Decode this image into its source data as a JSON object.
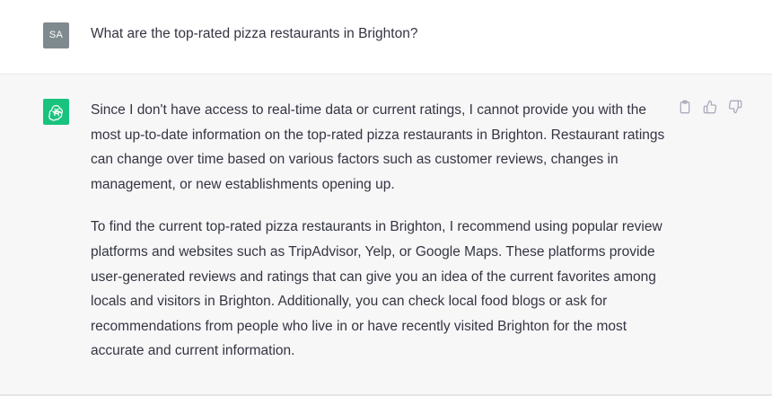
{
  "user_message": {
    "avatar_initials": "SA",
    "text": "What are the top-rated pizza restaurants in Brighton?"
  },
  "assistant_message": {
    "paragraphs": [
      "Since I don't have access to real-time data or current ratings, I cannot provide you with the most up-to-date information on the top-rated pizza restaurants in Brighton. Restaurant ratings can change over time based on various factors such as customer reviews, changes in management, or new establishments opening up.",
      "To find the current top-rated pizza restaurants in Brighton, I recommend using popular review platforms and websites such as TripAdvisor, Yelp, or Google Maps. These platforms provide user-generated reviews and ratings that can give you an idea of the current favorites among locals and visitors in Brighton. Additionally, you can check local food blogs or ask for recommendations from people who live in or have recently visited Brighton for the most accurate and current information."
    ],
    "actions": [
      "clipboard-icon",
      "thumbs-up-icon",
      "thumbs-down-icon"
    ]
  },
  "colors": {
    "user_avatar": "#7f8a8e",
    "assistant_avatar": "#19c37d",
    "assistant_bg": "#f7f7f8",
    "text": "#343541",
    "icon": "#acacbe"
  }
}
